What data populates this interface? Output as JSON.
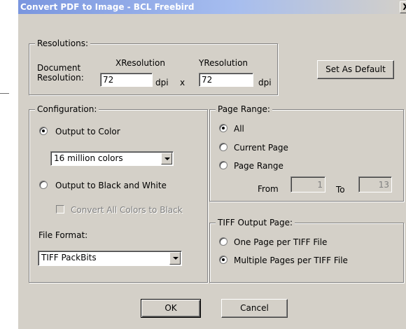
{
  "window": {
    "title": "Convert PDF to Image - BCL Freebird",
    "close_label": "X"
  },
  "resolutions": {
    "legend": "Resolutions:",
    "doc_label_line1": "Document",
    "doc_label_line2": "Resolution:",
    "x_header": "XResolution",
    "y_header": "YResolution",
    "x_value": "72",
    "y_value": "72",
    "x_unit": "dpi",
    "times": "x",
    "y_unit": "dpi",
    "set_default_label": "Set As Default"
  },
  "configuration": {
    "legend": "Configuration:",
    "output_color_label": "Output to Color",
    "color_depth_selected": "16 million colors",
    "output_bw_label": "Output to Black and White",
    "convert_black_label": "Convert All Colors to Black",
    "file_format_label": "File Format:",
    "file_format_selected": "TIFF PackBits",
    "selected_output": "color"
  },
  "page_range": {
    "legend": "Page Range:",
    "all_label": "All",
    "current_label": "Current Page",
    "range_label": "Page Range",
    "from_label": "From",
    "from_value": "1",
    "to_label": "To",
    "to_value": "13",
    "selected": "all"
  },
  "tiff_output": {
    "legend": "TIFF Output Page:",
    "one_page_label": "One Page per TIFF File",
    "multi_page_label": "Multiple Pages per TIFF File",
    "selected": "multiple"
  },
  "buttons": {
    "ok_label": "OK",
    "cancel_label": "Cancel"
  }
}
